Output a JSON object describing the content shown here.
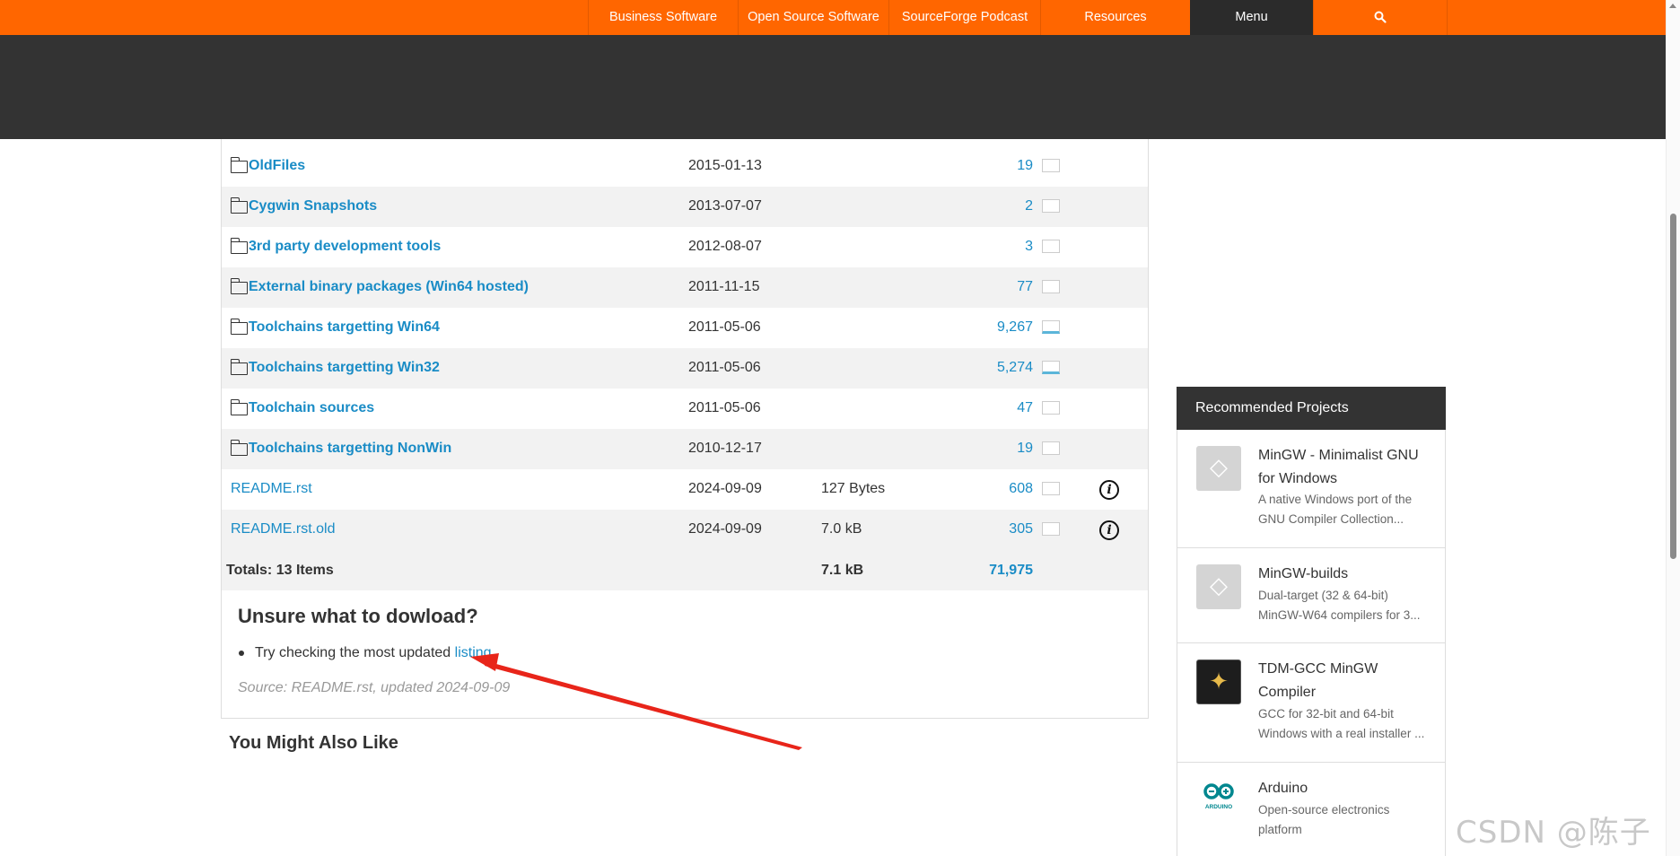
{
  "nav": {
    "items": [
      "Business Software",
      "Open Source Software",
      "SourceForge Podcast",
      "Resources",
      "Menu"
    ],
    "search_icon": "search-icon"
  },
  "files": [
    {
      "name": "OldFiles",
      "type": "folder",
      "date": "2015-01-13",
      "size": "",
      "downloads": "19"
    },
    {
      "name": "Cygwin Snapshots",
      "type": "folder",
      "date": "2013-07-07",
      "size": "",
      "downloads": "2"
    },
    {
      "name": "3rd party development tools",
      "type": "folder",
      "date": "2012-08-07",
      "size": "",
      "downloads": "3"
    },
    {
      "name": "External binary packages (Win64 hosted)",
      "type": "folder",
      "date": "2011-11-15",
      "size": "",
      "downloads": "77"
    },
    {
      "name": "Toolchains targetting Win64",
      "type": "folder",
      "date": "2011-05-06",
      "size": "",
      "downloads": "9,267"
    },
    {
      "name": "Toolchains targetting Win32",
      "type": "folder",
      "date": "2011-05-06",
      "size": "",
      "downloads": "5,274"
    },
    {
      "name": "Toolchain sources",
      "type": "folder",
      "date": "2011-05-06",
      "size": "",
      "downloads": "47"
    },
    {
      "name": "Toolchains targetting NonWin",
      "type": "folder",
      "date": "2010-12-17",
      "size": "",
      "downloads": "19"
    },
    {
      "name": "README.rst",
      "type": "file",
      "date": "2024-09-09",
      "size": "127 Bytes",
      "downloads": "608"
    },
    {
      "name": "README.rst.old",
      "type": "file",
      "date": "2024-09-09",
      "size": "7.0 kB",
      "downloads": "305"
    }
  ],
  "totals": {
    "label": "Totals: 13 Items",
    "size": "7.1 kB",
    "downloads": "71,975"
  },
  "readme": {
    "title": "Unsure what to dowload?",
    "bullet_text": "Try checking the most updated ",
    "bullet_link": "listing",
    "source": "Source: README.rst, updated 2024-09-09"
  },
  "also_like": "You Might Also Like",
  "recommended": {
    "header": "Recommended Projects",
    "items": [
      {
        "title": "MinGW - Minimalist GNU for Windows",
        "desc": "A native Windows port of the GNU Compiler Collection...",
        "icon": "sourceforge-placeholder-icon"
      },
      {
        "title": "MinGW-builds",
        "desc": "Dual-target (32 & 64-bit) MinGW-W64 compilers for 3...",
        "icon": "sourceforge-placeholder-icon"
      },
      {
        "title": "TDM-GCC MinGW Compiler",
        "desc": "GCC for 32-bit and 64-bit Windows with a real installer ...",
        "icon": "tdm-gcc-icon"
      },
      {
        "title": "Arduino",
        "desc": "Open-source electronics platform",
        "icon": "arduino-icon",
        "icon_text": "ARDUINO"
      }
    ]
  },
  "watermark": "CSDN @陈子迩",
  "colors": {
    "brand_orange": "#ff6600",
    "link_blue": "#1a8cc6",
    "dark": "#333333",
    "arrow_red": "#e8251a"
  }
}
